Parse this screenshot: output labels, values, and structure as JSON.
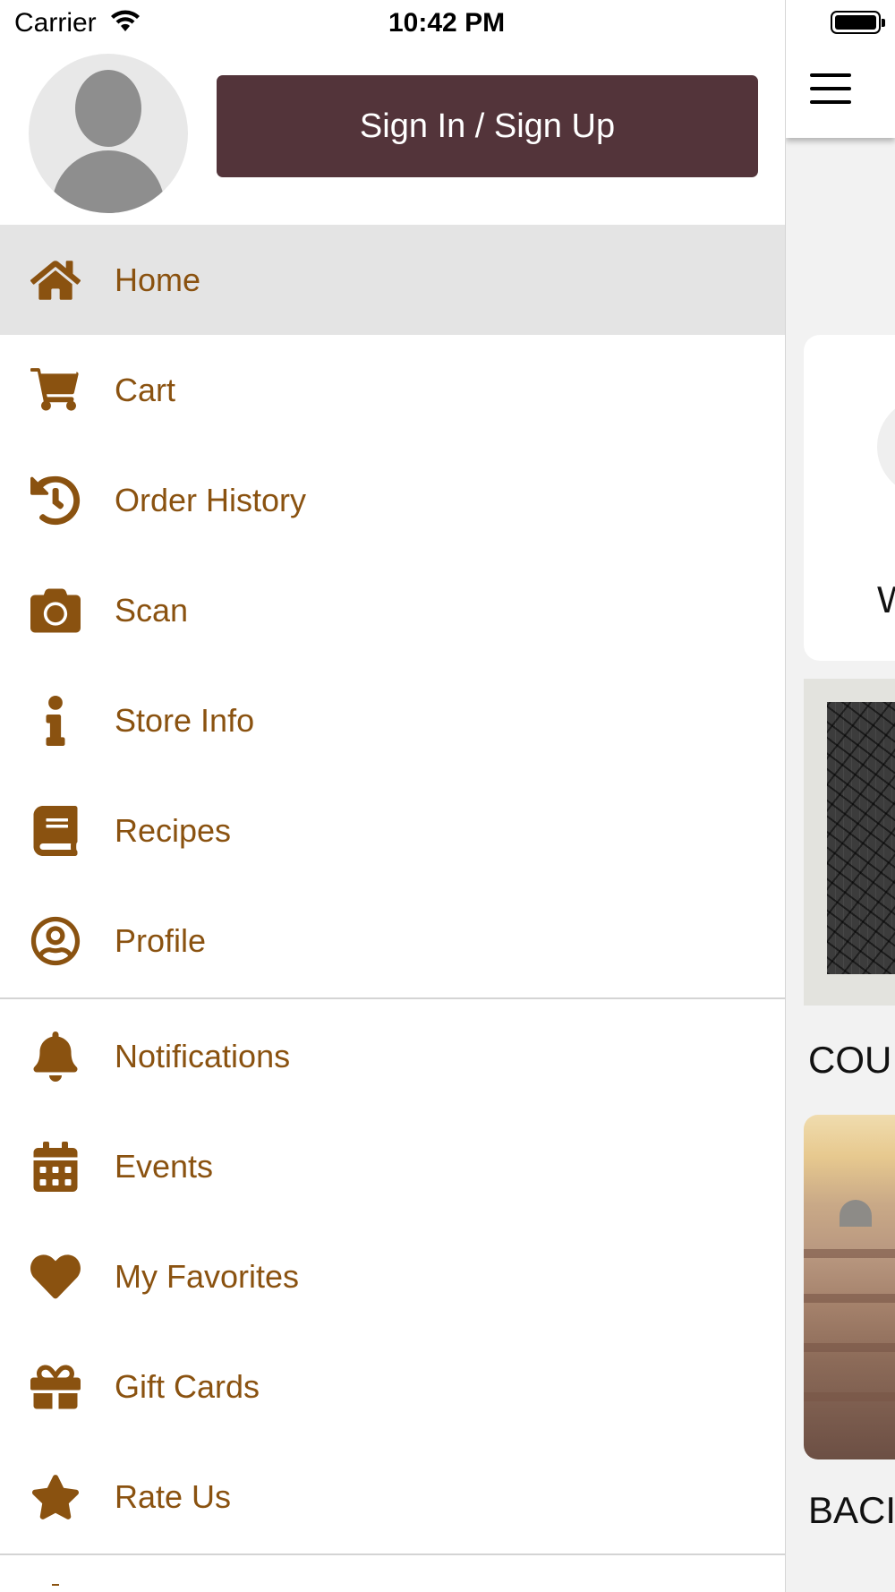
{
  "status_bar": {
    "carrier": "Carrier",
    "time": "10:42 PM"
  },
  "drawer": {
    "sign_in_label": "Sign In / Sign Up",
    "menu_section_1": [
      {
        "label": "Home",
        "icon": "home-icon",
        "active": true
      },
      {
        "label": "Cart",
        "icon": "cart-icon"
      },
      {
        "label": "Order History",
        "icon": "history-icon"
      },
      {
        "label": "Scan",
        "icon": "camera-icon"
      },
      {
        "label": "Store Info",
        "icon": "info-icon"
      },
      {
        "label": "Recipes",
        "icon": "book-icon"
      },
      {
        "label": "Profile",
        "icon": "user-circle-icon"
      }
    ],
    "menu_section_2": [
      {
        "label": "Notifications",
        "icon": "bell-icon"
      },
      {
        "label": "Events",
        "icon": "calendar-icon"
      },
      {
        "label": "My Favorites",
        "icon": "heart-icon"
      },
      {
        "label": "Gift Cards",
        "icon": "gift-icon"
      },
      {
        "label": "Rate Us",
        "icon": "star-icon"
      }
    ]
  },
  "background_app": {
    "card_letter": "W",
    "section_1_title": "COU",
    "section_2_title": "BACI"
  },
  "colors": {
    "accent": "#8a5210",
    "button_bg": "#53343a",
    "active_row": "#e4e4e4"
  }
}
